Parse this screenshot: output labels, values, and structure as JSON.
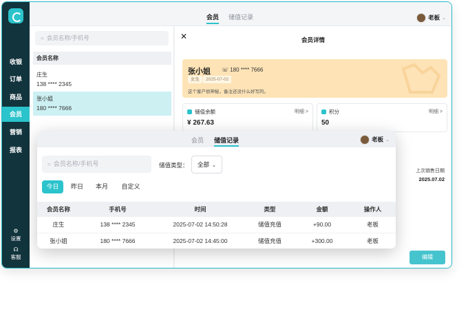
{
  "sidebar": {
    "items": [
      {
        "label": "收银"
      },
      {
        "label": "订单"
      },
      {
        "label": "商品"
      },
      {
        "label": "会员"
      },
      {
        "label": "营销"
      },
      {
        "label": "报表"
      }
    ],
    "bottom": [
      {
        "label": "设置",
        "icon": "gear-icon"
      },
      {
        "label": "客服",
        "icon": "headset-icon"
      }
    ],
    "accent": "#2bc3cc",
    "bg": "#12343d"
  },
  "header": {
    "tabs": [
      "会员",
      "储值记录"
    ],
    "active_tab": "会员",
    "user": "老板"
  },
  "member_list": {
    "search_placeholder": "会员名称/手机号",
    "column": "会员名称",
    "members": [
      {
        "name": "庄生",
        "phone": "138 **** 2345"
      },
      {
        "name": "张小姐",
        "phone": "180 **** 7666"
      }
    ]
  },
  "detail": {
    "title": "会员详情",
    "name": "张小姐",
    "phone": "180 **** 7666",
    "tags": [
      "女生",
      "2025-07-02"
    ],
    "note": "这个客户很神秘，备注还没什么好写的。",
    "balance": {
      "label": "储值余额",
      "link": "明细 >",
      "value": "¥ 267.63"
    },
    "points": {
      "label": "积分",
      "link": "明细 >",
      "value": "50"
    },
    "last_sale_label": "上次销售日期",
    "last_sale_date": "2025.07.02",
    "edit_label": "编辑"
  },
  "overlay": {
    "tabs": [
      "会员",
      "储值记录"
    ],
    "active_tab": "储值记录",
    "user": "老板",
    "search_placeholder": "会员名称/手机号",
    "type_label": "储值类型：",
    "type_value": "全部",
    "ranges": [
      "今日",
      "昨日",
      "本月",
      "自定义"
    ],
    "active_range": "今日",
    "columns": [
      "会员名称",
      "手机号",
      "时间",
      "类型",
      "金额",
      "操作人"
    ],
    "rows": [
      [
        "庄生",
        "138 **** 2345",
        "2025-07-02 14:50:28",
        "储值充值",
        "+90.00",
        "老板"
      ],
      [
        "张小姐",
        "180 **** 7666",
        "2025-07-02 14:45:00",
        "储值充值",
        "+300.00",
        "老板"
      ]
    ]
  }
}
